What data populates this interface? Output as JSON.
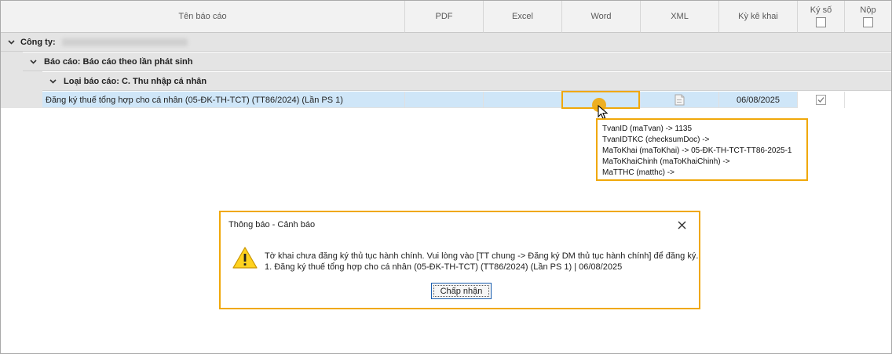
{
  "columns": {
    "report_name": "Tên báo cáo",
    "pdf": "PDF",
    "excel": "Excel",
    "word": "Word",
    "xml": "XML",
    "period": "Kỳ kê khai",
    "signed": "Ký số",
    "submit": "Nộp"
  },
  "groups": {
    "company_label": "Công ty:",
    "report_label": "Báo cáo: Báo cáo theo lần phát sinh",
    "type_label": "Loại báo cáo: C. Thu nhập cá nhân"
  },
  "row": {
    "name": "Đăng ký thuế tổng hợp cho cá nhân (05-ĐK-TH-TCT) (TT86/2024) (Lần PS 1)",
    "period": "06/08/2025",
    "signed": true,
    "xml_icon": "document-icon"
  },
  "tooltip": {
    "lines": [
      "TvanID (maTvan) -> 1135",
      "TvanIDTKC (checksumDoc) ->",
      "MaToKhai (maToKhai) -> 05-ĐK-TH-TCT-TT86-2025-1",
      "MaToKhaiChinh (maToKhaiChinh) ->",
      "MaTTHC (matthc) ->"
    ]
  },
  "dialog": {
    "title": "Thông báo - Cảnh báo",
    "message_line1": "Tờ khai chưa đăng ký thủ tục hành chính. Vui lòng vào [TT chung -> Đăng ký DM thủ tục hành chính] để đăng ký.",
    "message_line2": "1. Đăng ký thuế tổng hợp cho cá nhân (05-ĐK-TH-TCT) (TT86/2024) (Lần PS 1) | 06/08/2025",
    "ok_label": "Chấp nhận",
    "icon": "warning-icon"
  },
  "colors": {
    "highlight": "#f0a80a",
    "selected_row": "#cfe6f8",
    "group_bg": "#e4e4e4",
    "header_bg": "#f2f2f2"
  }
}
